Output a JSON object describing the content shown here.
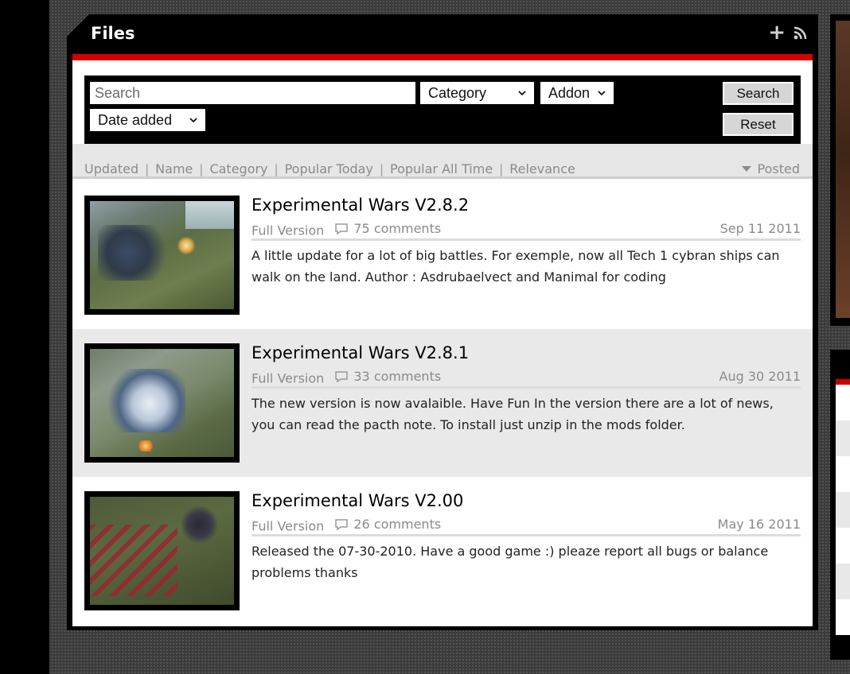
{
  "panel": {
    "title": "Files"
  },
  "search": {
    "placeholder": "Search",
    "category": "Category",
    "addon": "Addon",
    "sort": "Date added",
    "search_button": "Search",
    "reset_button": "Reset"
  },
  "sortbar": {
    "links": [
      "Updated",
      "Name",
      "Category",
      "Popular Today",
      "Popular All Time",
      "Relevance"
    ],
    "active": "Posted"
  },
  "files": [
    {
      "title": "Experimental Wars V2.8.2",
      "category": "Full Version",
      "comments": "75 comments",
      "date": "Sep 11 2011",
      "summary": "A little update for a lot of big battles. For exemple, now all Tech 1 cybran ships can walk on the land. Author : Asdrubaelvect and Manimal for coding"
    },
    {
      "title": "Experimental Wars V2.8.1",
      "category": "Full Version",
      "comments": "33 comments",
      "date": "Aug 30 2011",
      "summary": "The new version is now avalaible. Have Fun In the version there are a lot of news, you can read the pacth note. To install just unzip in the mods folder."
    },
    {
      "title": "Experimental Wars V2.00",
      "category": "Full Version",
      "comments": "26 comments",
      "date": "May 16 2011",
      "summary": "Released the 07-30-2010. Have a good game :) pleaze report all bugs or balance problems thanks"
    }
  ],
  "icons": {
    "add": "plus-icon",
    "feed": "rss-icon",
    "comment": "comment-bubble-icon",
    "dropdown": "chevron-down-icon"
  },
  "colors": {
    "accent": "#d40000",
    "panel": "#000000",
    "alt_row": "#e9e9e9"
  }
}
